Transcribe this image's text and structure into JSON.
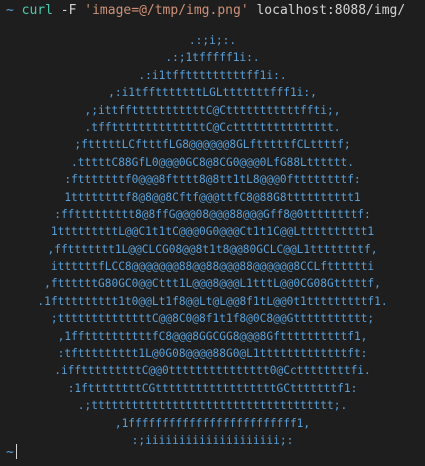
{
  "prompt": {
    "symbol": "~",
    "command": "curl",
    "flag": " -F ",
    "form_arg": "'image=@/tmp/img.png'",
    "url": " localhost:8088/img/"
  },
  "ascii_art": [
    ".:;i;:.",
    ".:;1tfffff1i:.",
    ".:i1tfftttttttttff1i:.",
    ",:i1tfftttttttLGLtttttttfff1i:,",
    ",;ittfftttttttttttC@Ctttttttttttffti;,",
    ".tffttttttttttttttC@Ccttttttttttttttt.",
    ";ftttttLCftttfLG8@@@@@@8GLftttttfCLttttf;",
    ".tttttC88GfL0@@@0GC8@8CG0@@@0LfG88Ltttttt.",
    ":ftttttttf0@@@8ftttt8@8tt1tL8@@@0fttttttttf:",
    "1ttttttttf8@8@@8Cftf@@@ttfC8@88G8tttttttttt1",
    ":ffttttttttt8@8ffG@@@08@@@88@@@Gff8@0ttttttttf:",
    "1tttttttttL@@C1t1tC@@@0G0@@@Ct1t1C@@Ltttttttttt1",
    ",ffttttttt1L@@CLCG08@@8t1t8@@80GCLC@@L1ttttttttf,",
    "ittttttfLCC8@@@@@@@88@@88@@@88@@@@@@8CCLftttttti",
    ",fttttttG80GC0@@Cttt1L@@@8@@@L1tttL@@0CG08Gtttttf,",
    ".1fttttttttt1t0@@Lt1f8@@Lt@L@@8f1tL@@0t1tttttttttf1.",
    ";ttttttttttttttC@@8C0@8f1t1f8@0C8@@Gttttttttttt;",
    ",1ffttttttttttfC8@@@8GGCGG8@@@8Gfttttttttttf1,",
    ":tfttttttttt1L@0G08@@@@88G0@L1tttttttttttttft:",
    ".ifftttttttttC@@0ttttttttttttttt0@Ccttttttttfi.",
    ":1fttttttttCGttttttttttttttttttGCtttttttf1:",
    ".;tttttttttttttttttttttttttttttttttttt;.",
    ",1fffffffffffffffffffffffff1,",
    ":;iiiiiiiiiiiiiiiiiiii;:"
  ],
  "bottom_prompt": {
    "symbol": "~"
  },
  "colors": {
    "background": "#1e1e1e",
    "art": "#5a9fd6",
    "command": "#4ec9b0",
    "string": "#ce9178",
    "text": "#d4d4d4"
  }
}
